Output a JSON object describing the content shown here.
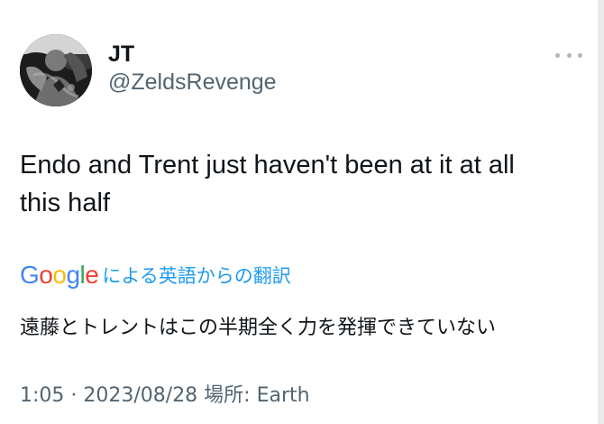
{
  "author": {
    "display_name": "JT",
    "handle": "@ZeldsRevenge",
    "avatar_icon": "profile-photo"
  },
  "tweet": {
    "text": "Endo and Trent just haven't been at it at all\nthis half"
  },
  "translation": {
    "provider_logo": "Google",
    "link_label": "による英語からの翻訳",
    "text": "遠藤とトレントはこの半期全く力を発揮できていない"
  },
  "meta": {
    "line": "1:05 · 2023/08/28 場所: Earth"
  },
  "actions": {
    "more_icon": "more-dots-icon"
  },
  "colors": {
    "text": "#0f1419",
    "secondary": "#536471",
    "link": "#1d9bf0",
    "google_blue": "#4285f4",
    "google_red": "#ea4335",
    "google_yellow": "#fbbc05",
    "google_green": "#34a853"
  }
}
